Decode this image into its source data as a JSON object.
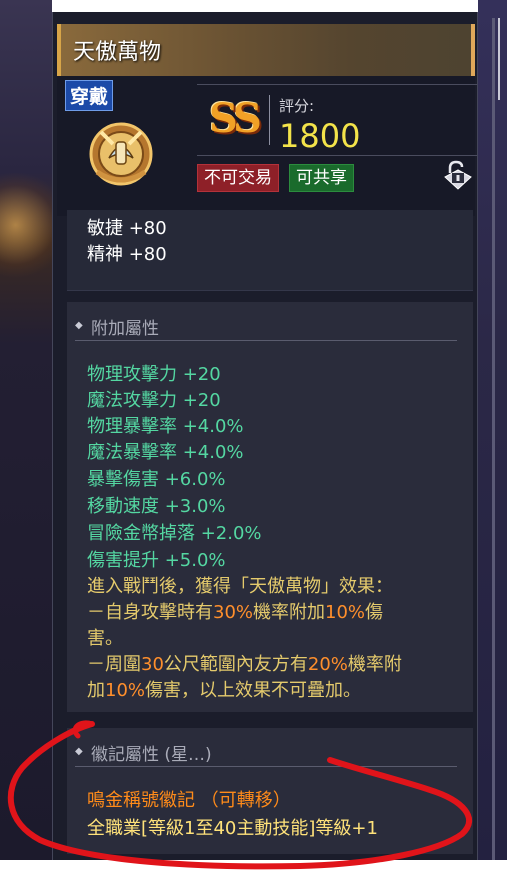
{
  "item": {
    "name": "天傲萬物",
    "wear_tag": "穿戴",
    "grade": "SS",
    "score_label": "評分:",
    "score_value": "1800",
    "badges": {
      "no_trade": "不可交易",
      "shareable": "可共享"
    }
  },
  "base_stats": [
    {
      "label": "敏捷 +80"
    },
    {
      "label": "精神 +80"
    }
  ],
  "additional": {
    "title": "附加屬性",
    "attributes": [
      "物理攻擊力 +20",
      "魔法攻擊力 +20",
      "物理暴擊率 +4.0%",
      "魔法暴擊率 +4.0%",
      "暴擊傷害 +6.0%",
      "移動速度 +3.0%",
      "冒險金幣掉落 +2.0%",
      "傷害提升 +5.0%"
    ],
    "effect": {
      "intro": "進入戰鬥後，獲得「天傲萬物」效果：",
      "line1a": "－自身攻擊時有",
      "line1b": "30%",
      "line1c": "機率附加",
      "line1d": "10%",
      "line1e": "傷",
      "line2": "害。",
      "line3a": "－周圍",
      "line3b": "30",
      "line3c": "公尺範圍內友方有",
      "line3d": "20%",
      "line3e": "機率附",
      "line4a": "加",
      "line4b": "10%",
      "line4c": "傷害，以上效果不可疊加。"
    }
  },
  "emblem": {
    "title": "徽記屬性 (星…)",
    "name": "鳴金稱號徽記 （可轉移）",
    "effect": "全職業[等級1至40主動技能]等級+1"
  },
  "colors": {
    "attribute_green": "#54d7a2",
    "effect_gold": "#e4ca6c",
    "highlight_orange": "#ff8f2c",
    "score_yellow": "#f3e34a",
    "annotation_red": "#e0141a"
  }
}
